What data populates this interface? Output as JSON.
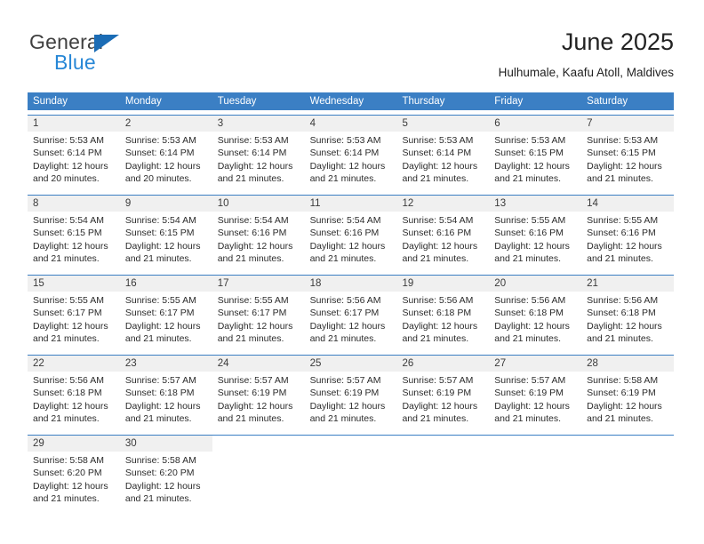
{
  "brand": {
    "name_top": "General",
    "name_bottom": "Blue",
    "accent_color": "#2787d6",
    "triangle_color": "#1b6cb5"
  },
  "header": {
    "title": "June 2025",
    "subtitle": "Hulhumale, Kaafu Atoll, Maldives"
  },
  "calendar": {
    "header_bg": "#3b7fc4",
    "header_text_color": "#ffffff",
    "daynum_bg": "#f0f0f0",
    "weekdays": [
      "Sunday",
      "Monday",
      "Tuesday",
      "Wednesday",
      "Thursday",
      "Friday",
      "Saturday"
    ],
    "weeks": [
      [
        {
          "day": "1",
          "sunrise": "Sunrise: 5:53 AM",
          "sunset": "Sunset: 6:14 PM",
          "daylight1": "Daylight: 12 hours",
          "daylight2": "and 20 minutes."
        },
        {
          "day": "2",
          "sunrise": "Sunrise: 5:53 AM",
          "sunset": "Sunset: 6:14 PM",
          "daylight1": "Daylight: 12 hours",
          "daylight2": "and 20 minutes."
        },
        {
          "day": "3",
          "sunrise": "Sunrise: 5:53 AM",
          "sunset": "Sunset: 6:14 PM",
          "daylight1": "Daylight: 12 hours",
          "daylight2": "and 21 minutes."
        },
        {
          "day": "4",
          "sunrise": "Sunrise: 5:53 AM",
          "sunset": "Sunset: 6:14 PM",
          "daylight1": "Daylight: 12 hours",
          "daylight2": "and 21 minutes."
        },
        {
          "day": "5",
          "sunrise": "Sunrise: 5:53 AM",
          "sunset": "Sunset: 6:14 PM",
          "daylight1": "Daylight: 12 hours",
          "daylight2": "and 21 minutes."
        },
        {
          "day": "6",
          "sunrise": "Sunrise: 5:53 AM",
          "sunset": "Sunset: 6:15 PM",
          "daylight1": "Daylight: 12 hours",
          "daylight2": "and 21 minutes."
        },
        {
          "day": "7",
          "sunrise": "Sunrise: 5:53 AM",
          "sunset": "Sunset: 6:15 PM",
          "daylight1": "Daylight: 12 hours",
          "daylight2": "and 21 minutes."
        }
      ],
      [
        {
          "day": "8",
          "sunrise": "Sunrise: 5:54 AM",
          "sunset": "Sunset: 6:15 PM",
          "daylight1": "Daylight: 12 hours",
          "daylight2": "and 21 minutes."
        },
        {
          "day": "9",
          "sunrise": "Sunrise: 5:54 AM",
          "sunset": "Sunset: 6:15 PM",
          "daylight1": "Daylight: 12 hours",
          "daylight2": "and 21 minutes."
        },
        {
          "day": "10",
          "sunrise": "Sunrise: 5:54 AM",
          "sunset": "Sunset: 6:16 PM",
          "daylight1": "Daylight: 12 hours",
          "daylight2": "and 21 minutes."
        },
        {
          "day": "11",
          "sunrise": "Sunrise: 5:54 AM",
          "sunset": "Sunset: 6:16 PM",
          "daylight1": "Daylight: 12 hours",
          "daylight2": "and 21 minutes."
        },
        {
          "day": "12",
          "sunrise": "Sunrise: 5:54 AM",
          "sunset": "Sunset: 6:16 PM",
          "daylight1": "Daylight: 12 hours",
          "daylight2": "and 21 minutes."
        },
        {
          "day": "13",
          "sunrise": "Sunrise: 5:55 AM",
          "sunset": "Sunset: 6:16 PM",
          "daylight1": "Daylight: 12 hours",
          "daylight2": "and 21 minutes."
        },
        {
          "day": "14",
          "sunrise": "Sunrise: 5:55 AM",
          "sunset": "Sunset: 6:16 PM",
          "daylight1": "Daylight: 12 hours",
          "daylight2": "and 21 minutes."
        }
      ],
      [
        {
          "day": "15",
          "sunrise": "Sunrise: 5:55 AM",
          "sunset": "Sunset: 6:17 PM",
          "daylight1": "Daylight: 12 hours",
          "daylight2": "and 21 minutes."
        },
        {
          "day": "16",
          "sunrise": "Sunrise: 5:55 AM",
          "sunset": "Sunset: 6:17 PM",
          "daylight1": "Daylight: 12 hours",
          "daylight2": "and 21 minutes."
        },
        {
          "day": "17",
          "sunrise": "Sunrise: 5:55 AM",
          "sunset": "Sunset: 6:17 PM",
          "daylight1": "Daylight: 12 hours",
          "daylight2": "and 21 minutes."
        },
        {
          "day": "18",
          "sunrise": "Sunrise: 5:56 AM",
          "sunset": "Sunset: 6:17 PM",
          "daylight1": "Daylight: 12 hours",
          "daylight2": "and 21 minutes."
        },
        {
          "day": "19",
          "sunrise": "Sunrise: 5:56 AM",
          "sunset": "Sunset: 6:18 PM",
          "daylight1": "Daylight: 12 hours",
          "daylight2": "and 21 minutes."
        },
        {
          "day": "20",
          "sunrise": "Sunrise: 5:56 AM",
          "sunset": "Sunset: 6:18 PM",
          "daylight1": "Daylight: 12 hours",
          "daylight2": "and 21 minutes."
        },
        {
          "day": "21",
          "sunrise": "Sunrise: 5:56 AM",
          "sunset": "Sunset: 6:18 PM",
          "daylight1": "Daylight: 12 hours",
          "daylight2": "and 21 minutes."
        }
      ],
      [
        {
          "day": "22",
          "sunrise": "Sunrise: 5:56 AM",
          "sunset": "Sunset: 6:18 PM",
          "daylight1": "Daylight: 12 hours",
          "daylight2": "and 21 minutes."
        },
        {
          "day": "23",
          "sunrise": "Sunrise: 5:57 AM",
          "sunset": "Sunset: 6:18 PM",
          "daylight1": "Daylight: 12 hours",
          "daylight2": "and 21 minutes."
        },
        {
          "day": "24",
          "sunrise": "Sunrise: 5:57 AM",
          "sunset": "Sunset: 6:19 PM",
          "daylight1": "Daylight: 12 hours",
          "daylight2": "and 21 minutes."
        },
        {
          "day": "25",
          "sunrise": "Sunrise: 5:57 AM",
          "sunset": "Sunset: 6:19 PM",
          "daylight1": "Daylight: 12 hours",
          "daylight2": "and 21 minutes."
        },
        {
          "day": "26",
          "sunrise": "Sunrise: 5:57 AM",
          "sunset": "Sunset: 6:19 PM",
          "daylight1": "Daylight: 12 hours",
          "daylight2": "and 21 minutes."
        },
        {
          "day": "27",
          "sunrise": "Sunrise: 5:57 AM",
          "sunset": "Sunset: 6:19 PM",
          "daylight1": "Daylight: 12 hours",
          "daylight2": "and 21 minutes."
        },
        {
          "day": "28",
          "sunrise": "Sunrise: 5:58 AM",
          "sunset": "Sunset: 6:19 PM",
          "daylight1": "Daylight: 12 hours",
          "daylight2": "and 21 minutes."
        }
      ],
      [
        {
          "day": "29",
          "sunrise": "Sunrise: 5:58 AM",
          "sunset": "Sunset: 6:20 PM",
          "daylight1": "Daylight: 12 hours",
          "daylight2": "and 21 minutes."
        },
        {
          "day": "30",
          "sunrise": "Sunrise: 5:58 AM",
          "sunset": "Sunset: 6:20 PM",
          "daylight1": "Daylight: 12 hours",
          "daylight2": "and 21 minutes."
        },
        {
          "day": "",
          "sunrise": "",
          "sunset": "",
          "daylight1": "",
          "daylight2": ""
        },
        {
          "day": "",
          "sunrise": "",
          "sunset": "",
          "daylight1": "",
          "daylight2": ""
        },
        {
          "day": "",
          "sunrise": "",
          "sunset": "",
          "daylight1": "",
          "daylight2": ""
        },
        {
          "day": "",
          "sunrise": "",
          "sunset": "",
          "daylight1": "",
          "daylight2": ""
        },
        {
          "day": "",
          "sunrise": "",
          "sunset": "",
          "daylight1": "",
          "daylight2": ""
        }
      ]
    ]
  }
}
